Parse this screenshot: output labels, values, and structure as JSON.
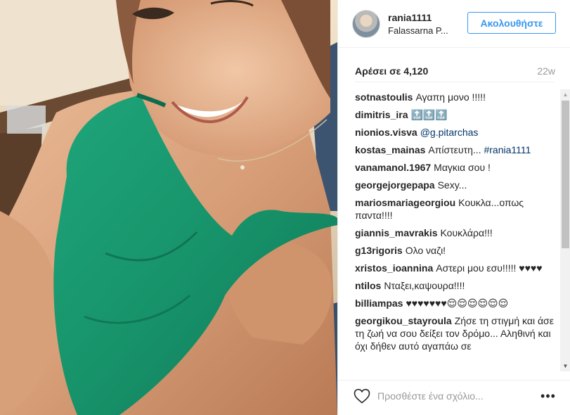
{
  "post": {
    "username": "rania1111",
    "location": "Falassarna P...",
    "follow_label": "Ακολουθήστε",
    "likes": "Αρέσει σε 4,120",
    "time": "22w"
  },
  "comments": [
    {
      "user": "sotnastoulis",
      "text": "Αγαπη μονο !!!!!"
    },
    {
      "user": "dimitris_ira",
      "text": "🔝🔝🔝"
    },
    {
      "user": "nionios.visva",
      "text": "",
      "tag": "@g.pitarchas"
    },
    {
      "user": "kostas_mainas",
      "text": "Απίστευτη... ",
      "tag": "#rania1111"
    },
    {
      "user": "vanamanol.1967",
      "text": "Μαγκια σου !"
    },
    {
      "user": "georgejorgepapa",
      "text": "Sexy..."
    },
    {
      "user": "mariosmariageorgiou",
      "text": "Κουκλα...οπως παντα!!!!"
    },
    {
      "user": "giannis_mavrakis",
      "text": "Κουκλάρα!!!"
    },
    {
      "user": "g13rigoris",
      "text": "Ολο ναζι!"
    },
    {
      "user": "xristos_ioannina",
      "text": "Αστερι μου εσυ!!!!! ♥♥♥♥"
    },
    {
      "user": "ntilos",
      "text": "Νταξει,καψουρα!!!!"
    },
    {
      "user": "billiampas",
      "text": "♥♥♥♥♥♥♥😌😌😌😌😌😌"
    },
    {
      "user": "georgikou_stayroula",
      "text": "Ζήσε τη στιγμή και άσε τη ζωή να σου δείξει τον δρόμο... Αληθινή και όχι δήθεν αυτό αγαπάω σε"
    }
  ],
  "comment_box": {
    "placeholder": "Προσθέστε ένα σχόλιο..."
  },
  "icons": {
    "heart": "heart-outline-icon",
    "more": "more-options-icon"
  },
  "colors": {
    "accent": "#3897f0",
    "tag": "#003569",
    "muted": "#999999"
  }
}
